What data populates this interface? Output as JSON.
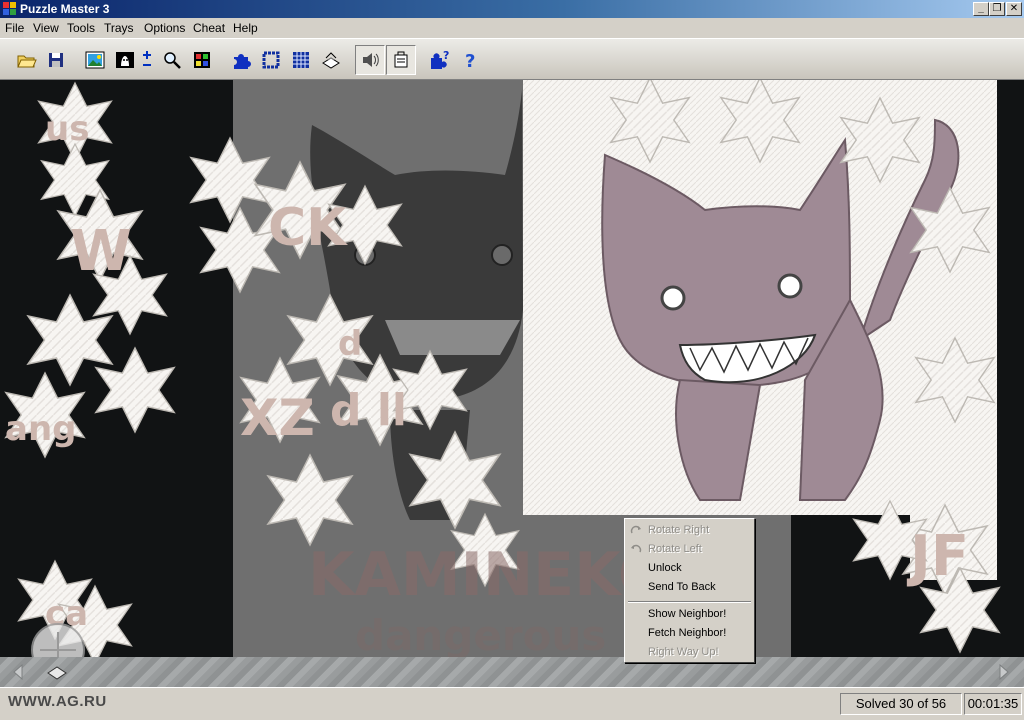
{
  "window": {
    "title": "Puzzle Master 3",
    "minimize_glyph": "_",
    "restore_glyph": "❐",
    "close_glyph": "✕"
  },
  "menu": {
    "items": [
      "File",
      "View",
      "Tools",
      "Trays",
      "Options",
      "Cheat",
      "Help"
    ]
  },
  "toolbar": {
    "icons": [
      "open-folder-icon",
      "save-disk-icon",
      "picture-icon",
      "ghost-image-icon",
      "zoom-plus-minus-icon",
      "magnifier-icon",
      "color-grid-icon",
      "piece-icon",
      "border-pieces-icon",
      "grid-icon",
      "tray-arrange-icon",
      "sound-icon",
      "notes-icon",
      "puzzle-help-icon",
      "help-icon"
    ]
  },
  "canvas": {
    "letters": {
      "left_us": "us",
      "left_w": "W",
      "left_ang": "ang",
      "left_ca": "ca",
      "mid_ck": "CK",
      "mid_d": "d",
      "mid_xz": "XZ",
      "mid_dl": "d ll",
      "mid_kamin": "KAMINEKO",
      "mid_dangerous": "dangerous",
      "right_jf": "JF"
    }
  },
  "context_menu": {
    "items": [
      {
        "label": "Rotate Right",
        "enabled": false,
        "icon": "rotate-right-icon"
      },
      {
        "label": "Rotate Left",
        "enabled": false,
        "icon": "rotate-left-icon"
      },
      {
        "label": "Unlock",
        "enabled": true
      },
      {
        "label": "Send To Back",
        "enabled": true
      },
      {
        "label": "Show Neighbor!",
        "enabled": true
      },
      {
        "label": "Fetch Neighbor!",
        "enabled": true
      },
      {
        "label": "Right Way Up!",
        "enabled": false
      }
    ]
  },
  "status": {
    "solved": "Solved 30 of 56",
    "timer": "00:01:35",
    "watermark": "WWW.AG.RU"
  },
  "colors": {
    "canvas_bg": "#111314",
    "ghost_bg": "#6f6f6f",
    "cat_pink": "#9f8a95",
    "piece_white": "#f7f5f2"
  }
}
